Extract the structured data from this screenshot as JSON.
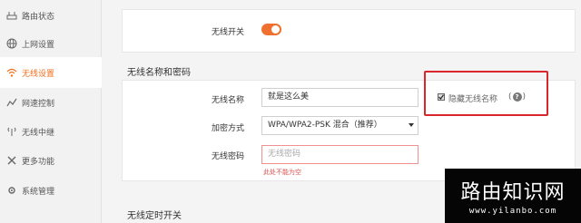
{
  "sidebar": {
    "items": [
      {
        "label": "路由状态",
        "icon": "router-icon"
      },
      {
        "label": "上网设置",
        "icon": "globe-icon"
      },
      {
        "label": "无线设置",
        "icon": "wifi-icon",
        "active": true
      },
      {
        "label": "网速控制",
        "icon": "chart-icon"
      },
      {
        "label": "无线中继",
        "icon": "antenna-icon"
      },
      {
        "label": "更多功能",
        "icon": "tools-icon"
      },
      {
        "label": "系统管理",
        "icon": "gear-icon"
      }
    ]
  },
  "wireless_switch": {
    "label": "无线开关",
    "on": true
  },
  "name_password": {
    "title": "无线名称和密码",
    "ssid_label": "无线名称",
    "ssid_value": "就是这么美",
    "hide_ssid_label": "隐藏无线名称",
    "hide_ssid_checked": true,
    "help_text_open": "(",
    "help_symbol": "?",
    "help_text_close": ")",
    "encryption_label": "加密方式",
    "encryption_value": "WPA/WPA2-PSK 混合（推荐）",
    "password_label": "无线密码",
    "password_placeholder": "无线密码",
    "password_error": "此处不能为空"
  },
  "schedule": {
    "title": "无线定时开关"
  },
  "watermark": {
    "title": "路由知识网",
    "url": "www.yilanbo.com"
  },
  "colors": {
    "accent": "#f07030",
    "active_nav": "#f07020",
    "error": "#d9534f",
    "highlight": "#d9262c"
  }
}
